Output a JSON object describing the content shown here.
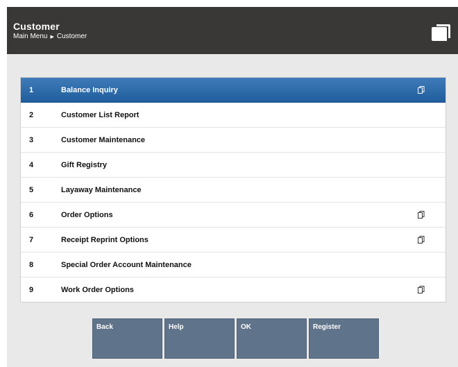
{
  "header": {
    "title": "Customer",
    "breadcrumb": [
      "Main Menu",
      "Customer"
    ]
  },
  "menu": {
    "items": [
      {
        "number": "1",
        "label": "Balance Inquiry",
        "has_submenu_icon": true,
        "selected": true
      },
      {
        "number": "2",
        "label": "Customer List Report",
        "has_submenu_icon": false,
        "selected": false
      },
      {
        "number": "3",
        "label": "Customer Maintenance",
        "has_submenu_icon": false,
        "selected": false
      },
      {
        "number": "4",
        "label": "Gift Registry",
        "has_submenu_icon": false,
        "selected": false
      },
      {
        "number": "5",
        "label": "Layaway Maintenance",
        "has_submenu_icon": false,
        "selected": false
      },
      {
        "number": "6",
        "label": "Order Options",
        "has_submenu_icon": true,
        "selected": false
      },
      {
        "number": "7",
        "label": "Receipt Reprint Options",
        "has_submenu_icon": true,
        "selected": false
      },
      {
        "number": "8",
        "label": "Special Order Account Maintenance",
        "has_submenu_icon": false,
        "selected": false
      },
      {
        "number": "9",
        "label": "Work Order Options",
        "has_submenu_icon": true,
        "selected": false
      }
    ]
  },
  "buttons": {
    "back": "Back",
    "help": "Help",
    "ok": "OK",
    "register": "Register"
  },
  "colors": {
    "header_bg": "#3a3836",
    "selected_row": "#2a6aab",
    "button_bg": "#5f738a",
    "panel_bg": "#e9e9e9"
  },
  "icons": {
    "header": "stacked-pages-icon",
    "row": "submenu-pages-icon"
  }
}
